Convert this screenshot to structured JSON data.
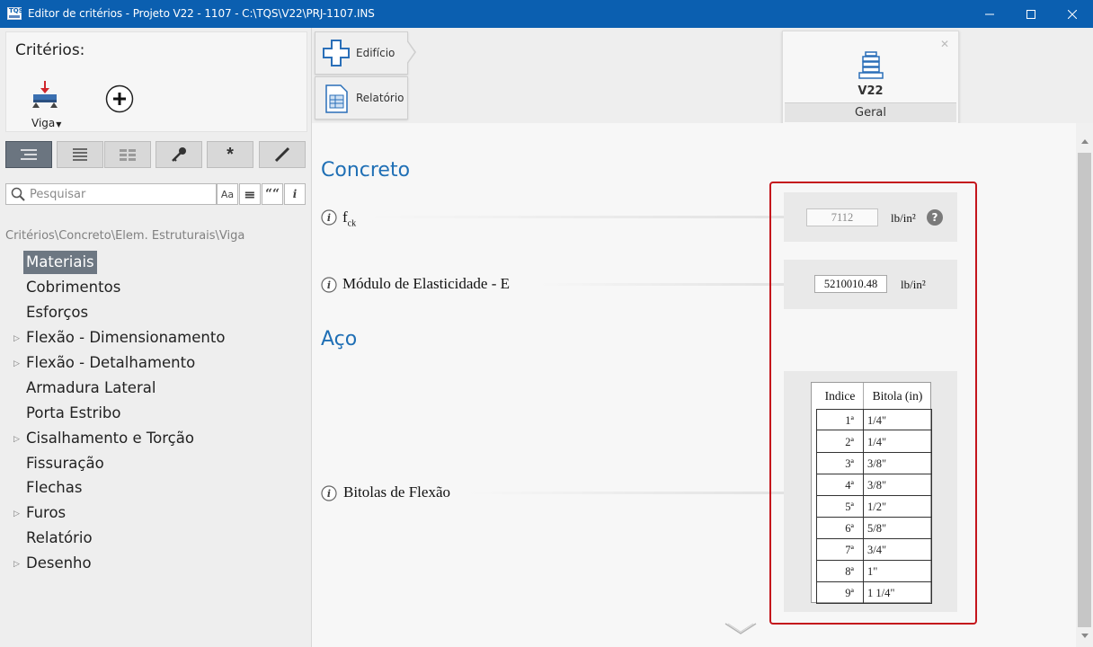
{
  "window": {
    "title": "Editor de critérios - Projeto V22 - 1107 - C:\\TQS\\V22\\PRJ-1107.INS",
    "controls": [
      "minimize",
      "maximize",
      "close"
    ]
  },
  "sidebar": {
    "criterios_title": "Critérios:",
    "viga_label": "Viga",
    "toolbar_icons": [
      "list-view-icon",
      "align-view-icon",
      "grid-view-icon",
      "key-icon",
      "asterisk-icon",
      "pencil-icon"
    ],
    "search": {
      "placeholder": "Pesquisar",
      "buttons": [
        "Aa",
        "≡",
        "““",
        "i"
      ]
    },
    "breadcrumb": "Critérios\\Concreto\\Elem. Estruturais\\Viga",
    "tree": [
      {
        "label": "Materiais",
        "selected": true,
        "expandable": false
      },
      {
        "label": "Cobrimentos",
        "selected": false,
        "expandable": false
      },
      {
        "label": "Esforços",
        "selected": false,
        "expandable": false
      },
      {
        "label": "Flexão - Dimensionamento",
        "selected": false,
        "expandable": true
      },
      {
        "label": "Flexão - Detalhamento",
        "selected": false,
        "expandable": true
      },
      {
        "label": "Armadura Lateral",
        "selected": false,
        "expandable": false
      },
      {
        "label": "Porta Estribo",
        "selected": false,
        "expandable": false
      },
      {
        "label": "Cisalhamento e Torção",
        "selected": false,
        "expandable": true
      },
      {
        "label": "Fissuração",
        "selected": false,
        "expandable": false
      },
      {
        "label": "Flechas",
        "selected": false,
        "expandable": false
      },
      {
        "label": "Furos",
        "selected": false,
        "expandable": true
      },
      {
        "label": "Relatório",
        "selected": false,
        "expandable": false
      },
      {
        "label": "Desenho",
        "selected": false,
        "expandable": true
      }
    ]
  },
  "ribbon": {
    "edificio_label": "Edifício",
    "relatorio_label": "Relatório"
  },
  "project_card": {
    "name": "V22",
    "tab": "Geral"
  },
  "content": {
    "concreto": {
      "title": "Concreto",
      "fck": {
        "label": "f",
        "sub": "ck",
        "value": "7112",
        "unit": "lb/in²",
        "help": "?"
      },
      "modulo": {
        "label": "Módulo de Elasticidade - E",
        "value": "5210010.48",
        "unit": "lb/in²"
      }
    },
    "aco": {
      "title": "Aço",
      "bitolas": {
        "label": "Bitolas de Flexão",
        "headers": [
          "Indice",
          "Bitola (in)"
        ],
        "rows": [
          [
            "1ª",
            "1/4\""
          ],
          [
            "2ª",
            "1/4\""
          ],
          [
            "3ª",
            "3/8\""
          ],
          [
            "4ª",
            "3/8\""
          ],
          [
            "5ª",
            "1/2\""
          ],
          [
            "6ª",
            "5/8\""
          ],
          [
            "7ª",
            "3/4\""
          ],
          [
            "8ª",
            "1\""
          ],
          [
            "9ª",
            "1 1/4\""
          ]
        ]
      }
    }
  },
  "colors": {
    "titlebar": "#0b5fb0",
    "section_title": "#1f6fb5",
    "selection": "#6d7782",
    "highlight_box": "#c4151c"
  }
}
